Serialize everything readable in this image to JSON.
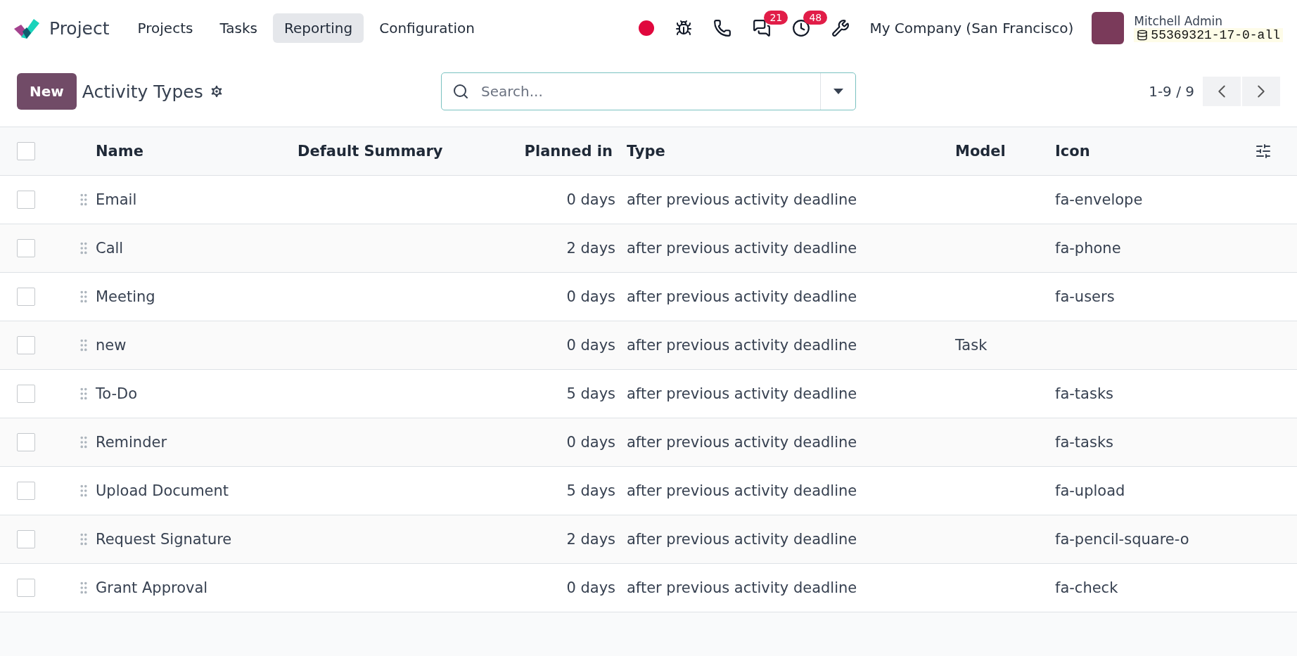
{
  "app": {
    "name": "Project"
  },
  "menu": [
    {
      "label": "Projects",
      "selected": false
    },
    {
      "label": "Tasks",
      "selected": false
    },
    {
      "label": "Reporting",
      "selected": true
    },
    {
      "label": "Configuration",
      "selected": false
    }
  ],
  "systray": {
    "messages_count": "21",
    "activities_count": "48",
    "company": "My Company (San Francisco)",
    "user": "Mitchell Admin",
    "database": "55369321-17-0-all"
  },
  "control_panel": {
    "new_button": "New",
    "title": "Activity Types",
    "search": {
      "placeholder": "Search..."
    },
    "pager": "1-9 / 9"
  },
  "table": {
    "columns": [
      "Name",
      "Default Summary",
      "Planned in",
      "Type",
      "Model",
      "Icon"
    ],
    "select_all": {
      "checked": false
    },
    "rows": [
      {
        "name": "Email",
        "planned": "0 days",
        "type": "after previous activity deadline",
        "icon": "fa-envelope",
        "checked": false
      },
      {
        "name": "Call",
        "planned": "2 days",
        "type": "after previous activity deadline",
        "icon": "fa-phone",
        "checked": false
      },
      {
        "name": "Meeting",
        "planned": "0 days",
        "type": "after previous activity deadline",
        "icon": "fa-users",
        "checked": false
      },
      {
        "name": "new",
        "planned": "0 days",
        "type": "after previous activity deadline",
        "model": "Task",
        "checked": false
      },
      {
        "name": "To-Do",
        "planned": "5 days",
        "type": "after previous activity deadline",
        "icon": "fa-tasks",
        "checked": false
      },
      {
        "name": "Reminder",
        "planned": "0 days",
        "type": "after previous activity deadline",
        "icon": "fa-tasks",
        "checked": false
      },
      {
        "name": "Upload Document",
        "planned": "5 days",
        "type": "after previous activity deadline",
        "icon": "fa-upload",
        "checked": false
      },
      {
        "name": "Request Signature",
        "planned": "2 days",
        "type": "after previous activity deadline",
        "icon": "fa-pencil-square-o",
        "checked": false
      },
      {
        "name": "Grant Approval",
        "planned": "0 days",
        "type": "after previous activity deadline",
        "icon": "fa-check",
        "checked": false
      }
    ]
  }
}
